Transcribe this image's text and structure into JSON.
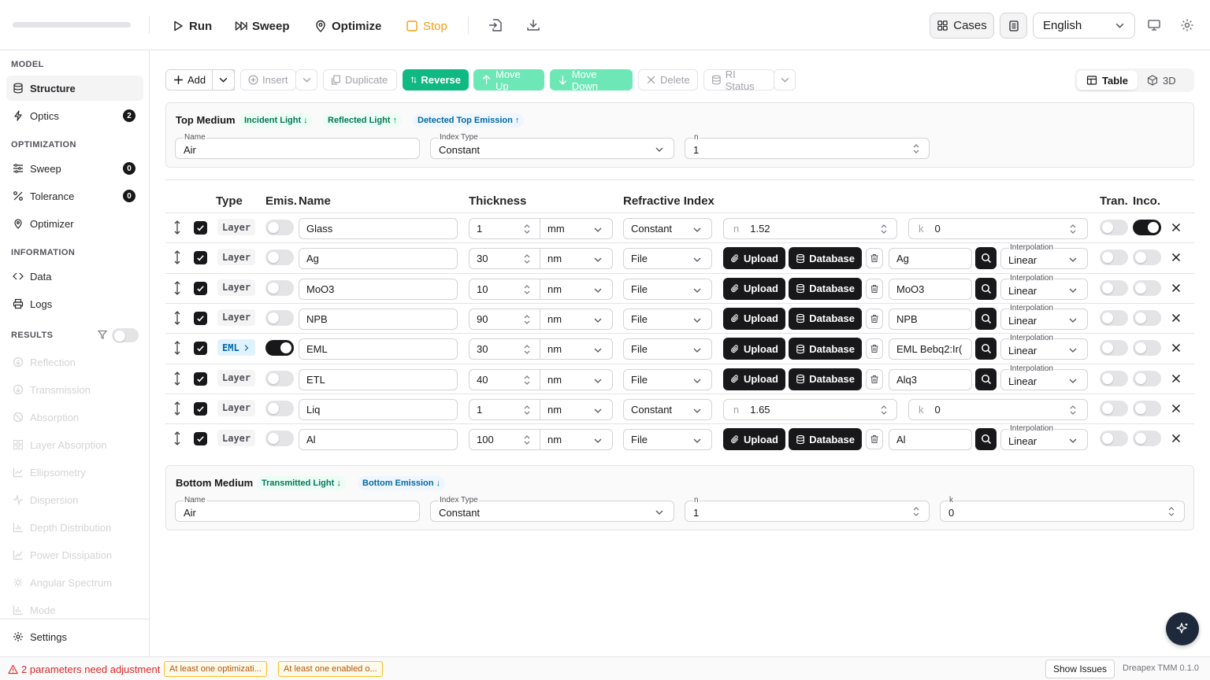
{
  "toolbar": {
    "run": "Run",
    "sweep": "Sweep",
    "optimize": "Optimize",
    "stop": "Stop",
    "cases": "Cases",
    "language": "English"
  },
  "sidebar": {
    "model_header": "MODEL",
    "structure": "Structure",
    "optics": "Optics",
    "optics_badge": "2",
    "optimization_header": "OPTIMIZATION",
    "sweep": "Sweep",
    "sweep_badge": "0",
    "tolerance": "Tolerance",
    "tolerance_badge": "0",
    "optimizer": "Optimizer",
    "information_header": "INFORMATION",
    "data": "Data",
    "logs": "Logs",
    "results_header": "RESULTS",
    "results": [
      "Reflection",
      "Transmission",
      "Absorption",
      "Layer Absorption",
      "Ellipsometry",
      "Dispersion",
      "Depth Distribution",
      "Power Dissipation",
      "Angular Spectrum",
      "Mode"
    ],
    "settings": "Settings"
  },
  "actions": {
    "add": "Add",
    "insert": "Insert",
    "duplicate": "Duplicate",
    "reverse": "Reverse",
    "move_up": "Move Up",
    "move_down": "Move Down",
    "delete": "Delete",
    "ri_status": "RI Status",
    "view_table": "Table",
    "view_3d": "3D"
  },
  "top_medium": {
    "title": "Top Medium",
    "tags": [
      "Incident Light ↓",
      "Reflected Light ↑",
      "Detected Top Emission ↑"
    ],
    "name_label": "Name",
    "name": "Air",
    "index_type_label": "Index Type",
    "index_type": "Constant",
    "n_label": "n",
    "n": "1"
  },
  "table": {
    "headers": {
      "type": "Type",
      "emis": "Emis.",
      "name": "Name",
      "thickness": "Thickness",
      "ri": "Refractive Index",
      "tran": "Tran.",
      "inco": "Inco."
    },
    "n_label": "n",
    "k_label": "k",
    "upload": "Upload",
    "database": "Database",
    "interp_label": "Interpolation",
    "rows": [
      {
        "type": "Layer",
        "emis": false,
        "name": "Glass",
        "thickness": "1",
        "unit": "mm",
        "index": "Constant",
        "n": "1.52",
        "k": "0",
        "tran": false,
        "inco": true
      },
      {
        "type": "Layer",
        "emis": false,
        "name": "Ag",
        "thickness": "30",
        "unit": "nm",
        "index": "File",
        "material": "Ag",
        "interp": "Linear",
        "tran": false,
        "inco": false
      },
      {
        "type": "Layer",
        "emis": false,
        "name": "MoO3",
        "thickness": "10",
        "unit": "nm",
        "index": "File",
        "material": "MoO3",
        "interp": "Linear",
        "tran": false,
        "inco": false
      },
      {
        "type": "Layer",
        "emis": false,
        "name": "NPB",
        "thickness": "90",
        "unit": "nm",
        "index": "File",
        "material": "NPB",
        "interp": "Linear",
        "tran": false,
        "inco": false
      },
      {
        "type": "EML",
        "emis": true,
        "name": "EML",
        "thickness": "30",
        "unit": "nm",
        "index": "File",
        "material": "EML Bebq2:Ir(",
        "interp": "Linear",
        "tran": false,
        "inco": false
      },
      {
        "type": "Layer",
        "emis": false,
        "name": "ETL",
        "thickness": "40",
        "unit": "nm",
        "index": "File",
        "material": "Alq3",
        "interp": "Linear",
        "tran": false,
        "inco": false
      },
      {
        "type": "Layer",
        "emis": false,
        "name": "Liq",
        "thickness": "1",
        "unit": "nm",
        "index": "Constant",
        "n": "1.65",
        "k": "0",
        "tran": false,
        "inco": false
      },
      {
        "type": "Layer",
        "emis": false,
        "name": "Al",
        "thickness": "100",
        "unit": "nm",
        "index": "File",
        "material": "Al",
        "interp": "Linear",
        "tran": false,
        "inco": false
      }
    ]
  },
  "bottom_medium": {
    "title": "Bottom Medium",
    "tags": [
      "Transmitted Light ↓",
      "Bottom Emission ↓"
    ],
    "name_label": "Name",
    "name": "Air",
    "index_type_label": "Index Type",
    "index_type": "Constant",
    "n_label": "n",
    "n": "1",
    "k_label": "k",
    "k": "0"
  },
  "status": {
    "warning": "2 parameters need adjustment",
    "chips": [
      "At least one optimizati...",
      "At least one enabled o..."
    ],
    "show_issues": "Show Issues",
    "version": "Dreapex TMM 0.1.0"
  }
}
